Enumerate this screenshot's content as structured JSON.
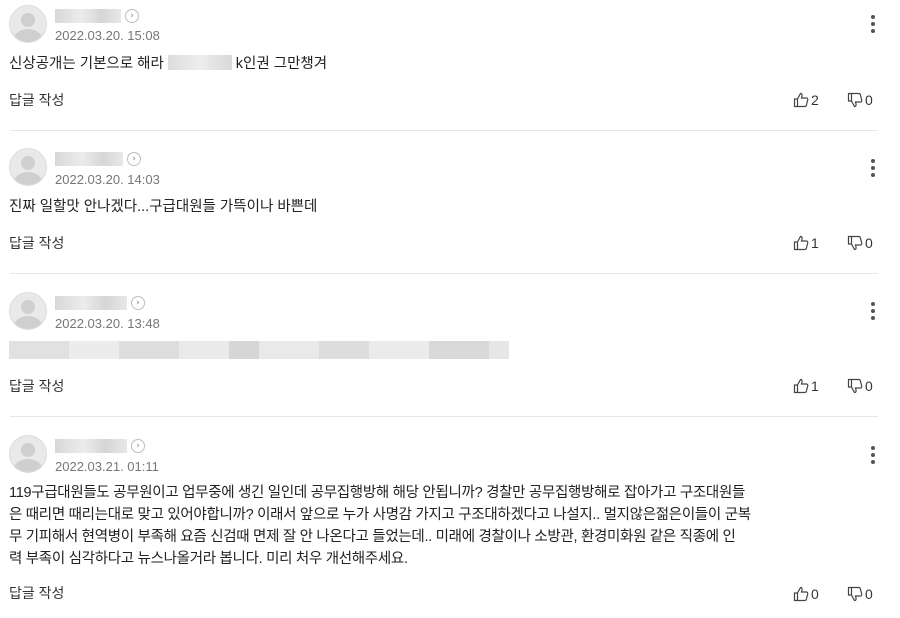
{
  "reply_label": "답글 작성",
  "comments": [
    {
      "date": "2022.03.20. 15:08",
      "text_before": "신상공개는 기본으로 해라",
      "text_after": "k인권 그만챙겨",
      "likes": "2",
      "dislikes": "0"
    },
    {
      "date": "2022.03.20. 14:03",
      "text": "진짜 일할맛 안나겠다...구급대원들 가뜩이나 바쁜데",
      "likes": "1",
      "dislikes": "0"
    },
    {
      "date": "2022.03.20. 13:48",
      "text": "",
      "likes": "1",
      "dislikes": "0"
    },
    {
      "date": "2022.03.21. 01:11",
      "text_lines": [
        "119구급대원들도 공무원이고 업무중에 생긴 일인데 공무집행방해 해당 안됩니까? 경찰만 공무집행방해로 잡아가고 구조대원들",
        "은 때리면 때리는대로 맞고 있어야합니까? 이래서 앞으로 누가 사명감 가지고 구조대하겠다고 나설지.. 멀지않은젊은이들이 군복",
        "무 기피해서 현역병이 부족해 요즘 신검때 면제 잘 안 나온다고 들었는데.. 미래에 경찰이나 소방관, 환경미화원 같은 직종에 인",
        "력 부족이 심각하다고 뉴스나올거라 봅니다. 미리 처우 개선해주세요."
      ],
      "likes": "0",
      "dislikes": "0"
    }
  ],
  "icons": {
    "avatar": "default-profile-icon",
    "profile_arrow": "chevron-right-icon",
    "more": "more-vertical-icon",
    "like": "thumbs-up-icon",
    "dislike": "thumbs-down-icon"
  },
  "colors": {
    "text": "#222222",
    "date": "#777777",
    "divider": "#e6e6e6",
    "redacted": "#dcdcdc"
  }
}
